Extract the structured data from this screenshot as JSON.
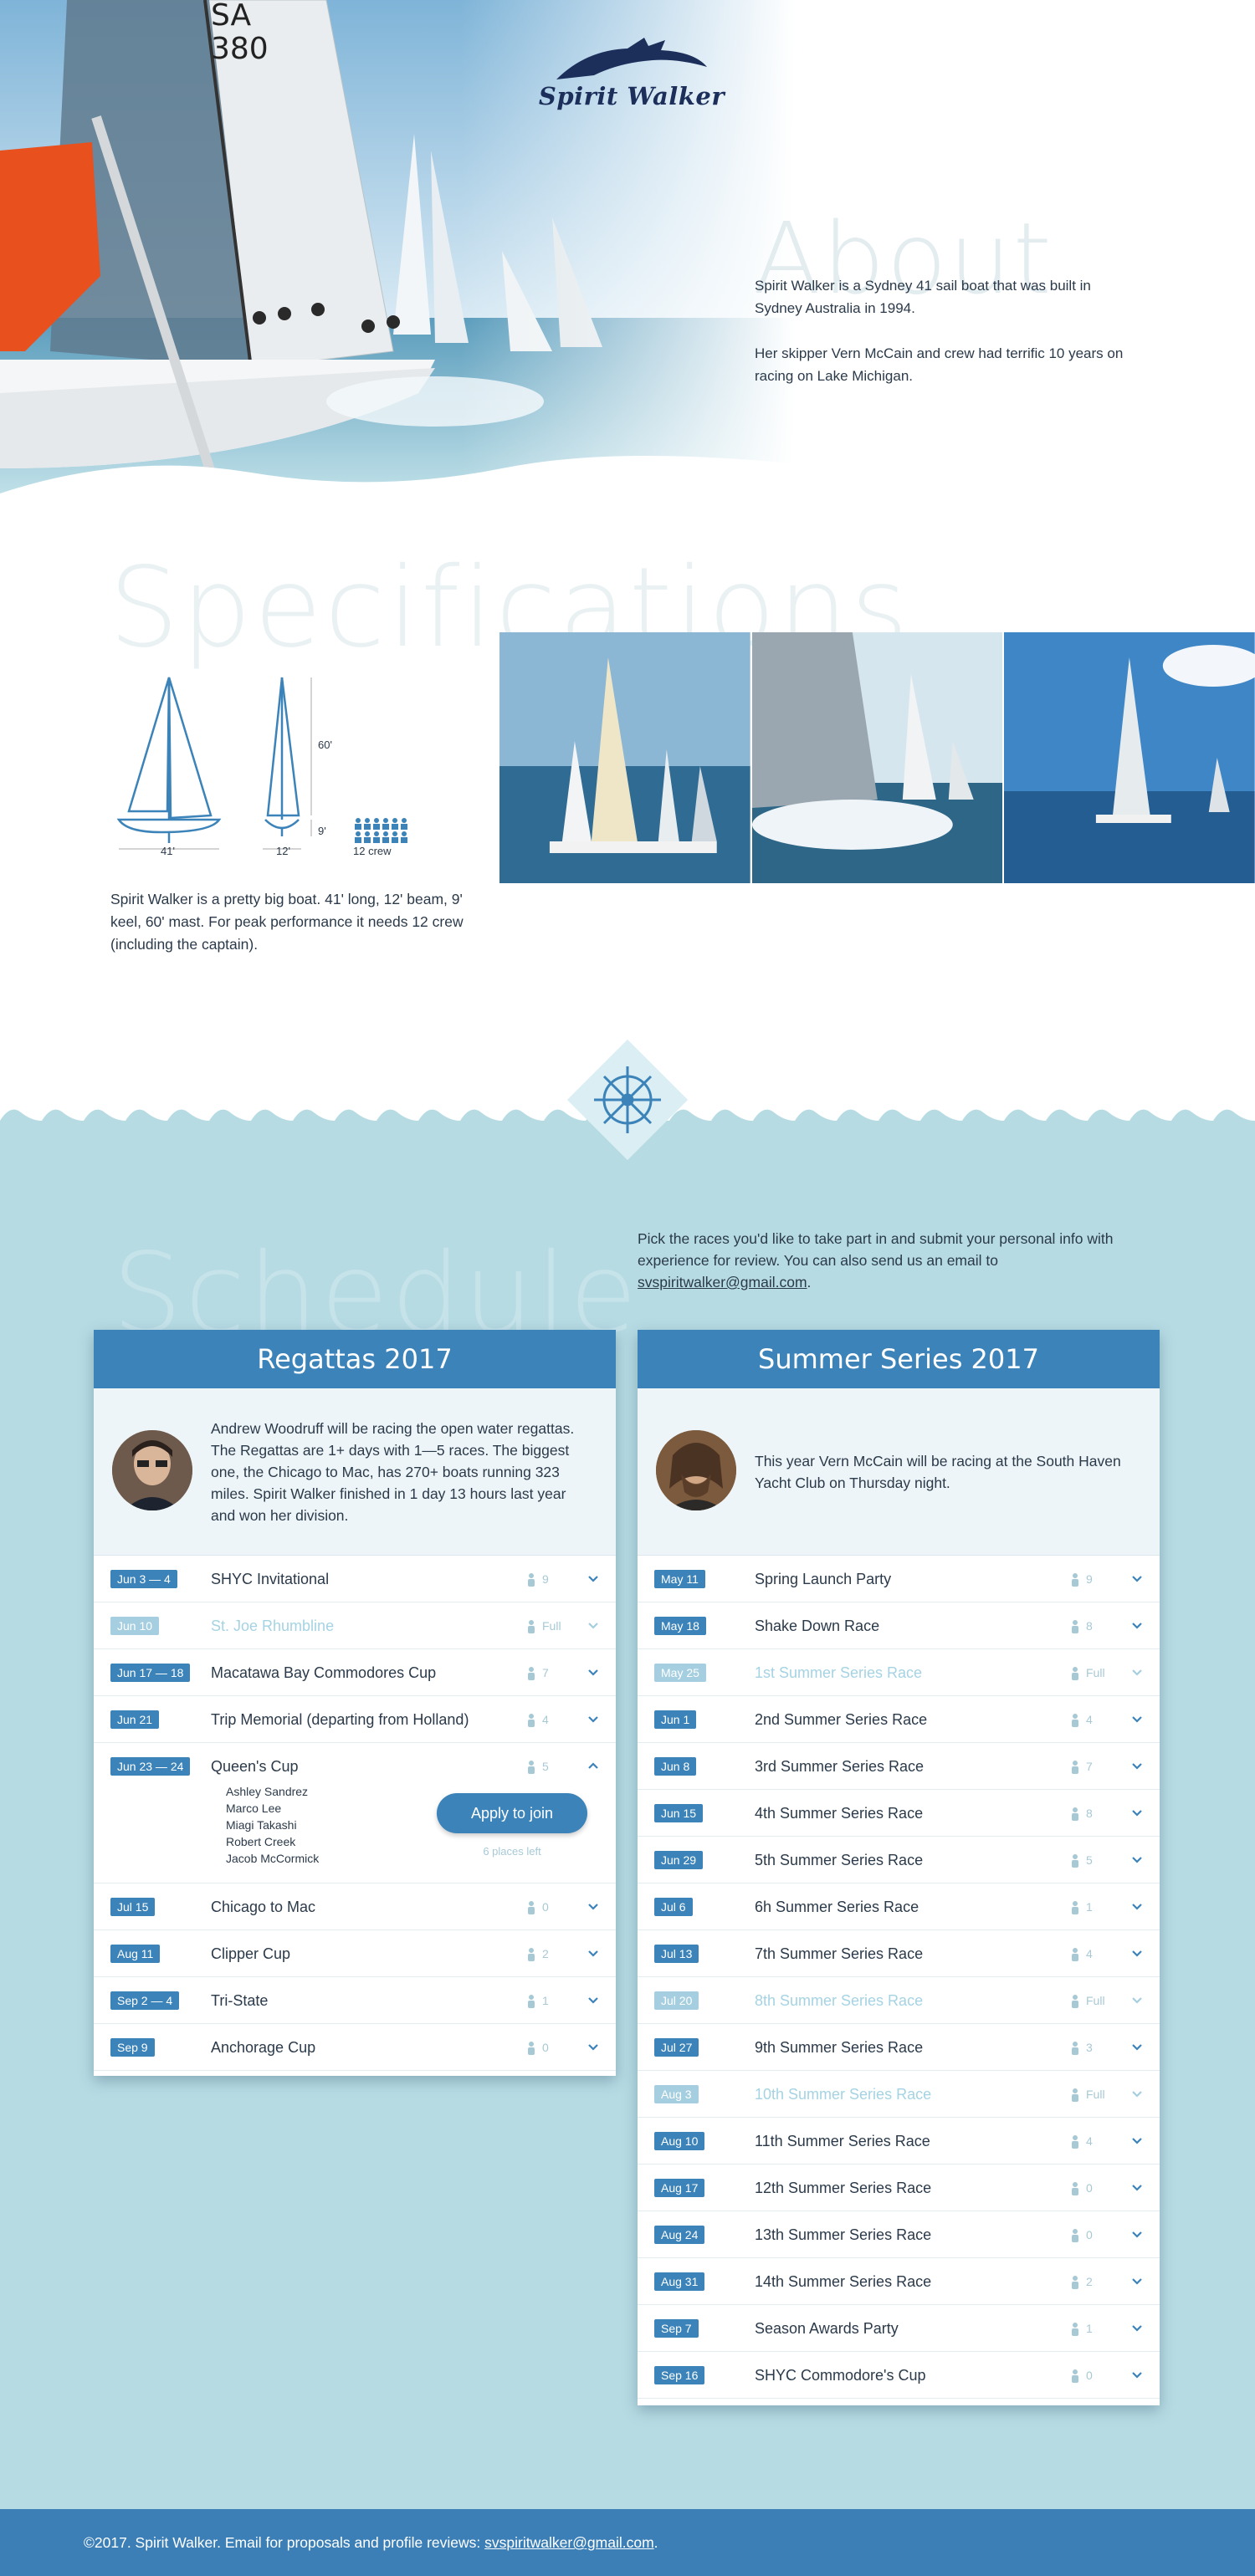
{
  "brand": {
    "name": "Spirit Walker"
  },
  "about": {
    "heading": "About",
    "paragraphs": [
      "Spirit Walker is a Sydney 41 sail boat that was built in Sydney Australia in 1994.",
      "Her skipper Vern McCain and crew had terrific 10 years on racing on Lake Michigan."
    ]
  },
  "specs": {
    "heading": "Specifications",
    "labels": {
      "length": "41'",
      "beam": "12'",
      "mast": "60'",
      "keel": "9'",
      "crew": "12 crew"
    },
    "crew_count": 12,
    "text": "Spirit Walker is a pretty big boat. 41' long, 12' beam, 9' keel, 60' mast. For peak performance it needs 12 crew (including the captain)."
  },
  "schedule": {
    "heading": "Schedule",
    "intro": "Pick the races you'd like to take part in and submit your personal info with experience for review. You can also send us an email to ",
    "email": "svspiritwalker@gmail.com",
    "intro_end": "."
  },
  "regattas": {
    "title": "Regattas 2017",
    "intro": "Andrew Woodruff will be racing the open water regattas. The Regattas are 1+ days with 1—5 races. The biggest one, the Chicago to Mac, has 270+ boats running 323 miles. Spirit Walker finished in 1 day 13 hours last year and won her division.",
    "rows": [
      {
        "date": "Jun 3 — 4",
        "title": "SHYC Invitational",
        "count": "9",
        "full": false
      },
      {
        "date": "Jun 10",
        "title": "St. Joe Rhumbline",
        "count": "Full",
        "full": true
      },
      {
        "date": "Jun 17 — 18",
        "title": "Macatawa Bay Commodores Cup",
        "count": "7",
        "full": false
      },
      {
        "date": "Jun 21",
        "title": "Trip Memorial (departing from Holland)",
        "count": "4",
        "full": false
      },
      {
        "date": "Jun 23 — 24",
        "title": "Queen's Cup",
        "count": "5",
        "full": false,
        "open": true,
        "crew": [
          "Ashley Sandrez",
          "Marco Lee",
          "Miagi Takashi",
          "Robert Creek",
          "Jacob McCormick"
        ],
        "apply": "Apply to join",
        "places": "6 places left"
      },
      {
        "date": "Jul 15",
        "title": "Chicago to Mac",
        "count": "0",
        "full": false
      },
      {
        "date": "Aug 11",
        "title": "Clipper Cup",
        "count": "2",
        "full": false
      },
      {
        "date": "Sep 2 — 4",
        "title": "Tri-State",
        "count": "1",
        "full": false
      },
      {
        "date": "Sep 9",
        "title": "Anchorage Cup",
        "count": "0",
        "full": false
      }
    ]
  },
  "summer": {
    "title": "Summer Series 2017",
    "intro": "This year Vern McCain will be racing at the South Haven Yacht Club on Thursday night.",
    "rows": [
      {
        "date": "May 11",
        "title": "Spring Launch Party",
        "count": "9",
        "full": false
      },
      {
        "date": "May 18",
        "title": "Shake Down Race",
        "count": "8",
        "full": false
      },
      {
        "date": "May 25",
        "title": "1st Summer Series Race",
        "count": "Full",
        "full": true
      },
      {
        "date": "Jun 1",
        "title": "2nd Summer Series Race",
        "count": "4",
        "full": false
      },
      {
        "date": "Jun 8",
        "title": "3rd Summer Series Race",
        "count": "7",
        "full": false
      },
      {
        "date": "Jun 15",
        "title": "4th Summer Series Race",
        "count": "8",
        "full": false
      },
      {
        "date": "Jun 29",
        "title": "5th Summer Series Race",
        "count": "5",
        "full": false
      },
      {
        "date": "Jul 6",
        "title": "6h Summer Series Race",
        "count": "1",
        "full": false
      },
      {
        "date": "Jul 13",
        "title": "7th Summer Series Race",
        "count": "4",
        "full": false
      },
      {
        "date": "Jul 20",
        "title": "8th Summer Series Race",
        "count": "Full",
        "full": true
      },
      {
        "date": "Jul 27",
        "title": "9th Summer Series Race",
        "count": "3",
        "full": false
      },
      {
        "date": "Aug 3",
        "title": "10th Summer Series Race",
        "count": "Full",
        "full": true
      },
      {
        "date": "Aug 10",
        "title": "11th Summer Series Race",
        "count": "4",
        "full": false
      },
      {
        "date": "Aug 17",
        "title": "12th Summer Series Race",
        "count": "0",
        "full": false
      },
      {
        "date": "Aug 24",
        "title": "13th Summer Series Race",
        "count": "0",
        "full": false
      },
      {
        "date": "Aug 31",
        "title": "14th Summer Series Race",
        "count": "2",
        "full": false
      },
      {
        "date": "Sep 7",
        "title": "Season Awards Party",
        "count": "1",
        "full": false
      },
      {
        "date": "Sep 16",
        "title": "SHYC Commodore's Cup",
        "count": "0",
        "full": false
      }
    ]
  },
  "footer": {
    "text": "©2017. Spirit Walker.  Email for proposals and profile reviews: ",
    "email": "svspiritwalker@gmail.com",
    "end": "."
  },
  "colors": {
    "accent": "#3b83b8",
    "schedule_bg": "#b7dbe3",
    "full": "#a5cfe0"
  }
}
